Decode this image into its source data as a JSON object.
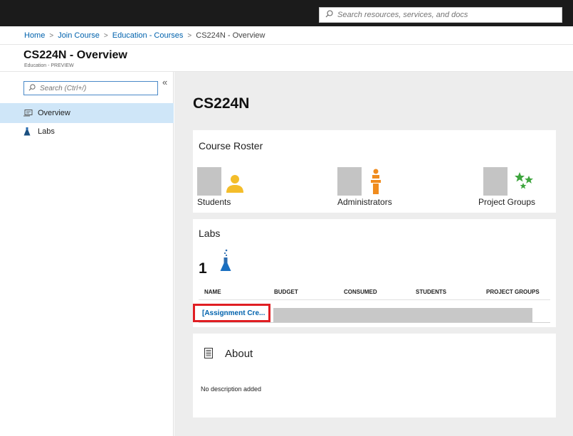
{
  "topbar": {
    "search_placeholder": "Search resources, services, and docs",
    "background": "#1b1b1b"
  },
  "breadcrumb": {
    "items": [
      "Home",
      "Join Course",
      "Education - Courses",
      "CS224N - Overview"
    ],
    "separator": ">"
  },
  "header": {
    "title": "CS224N - Overview",
    "subtitle": "Education - PREVIEW"
  },
  "sidebar": {
    "search_placeholder": "Search (Ctrl+/)",
    "collapse_glyph": "«",
    "items": [
      {
        "label": "Overview",
        "icon": "overview-icon",
        "active": true
      },
      {
        "label": "Labs",
        "icon": "flask-icon",
        "active": false
      }
    ]
  },
  "main": {
    "course_title": "CS224N",
    "roster": {
      "title": "Course Roster",
      "tiles": [
        {
          "label": "Students",
          "icon": "person-icon",
          "color": "#f4bd2a"
        },
        {
          "label": "Administrators",
          "icon": "presenter-icon",
          "color": "#f08c1e"
        },
        {
          "label": "Project Groups",
          "icon": "stars-icon",
          "color": "#3ea53e"
        }
      ]
    },
    "labs": {
      "title": "Labs",
      "count": "1",
      "icon": "flask-icon",
      "columns": [
        "NAME",
        "BUDGET",
        "CONSUMED",
        "STUDENTS",
        "PROJECT GROUPS"
      ],
      "rows": [
        {
          "name": "[Assignment Cre..."
        }
      ]
    },
    "about": {
      "title": "About",
      "icon": "document-icon",
      "description": "No description added"
    }
  },
  "colors": {
    "accent_link": "#0062ad",
    "highlight_border": "#e01e23",
    "active_nav": "#cfe6f8",
    "main_background": "#ededed"
  }
}
